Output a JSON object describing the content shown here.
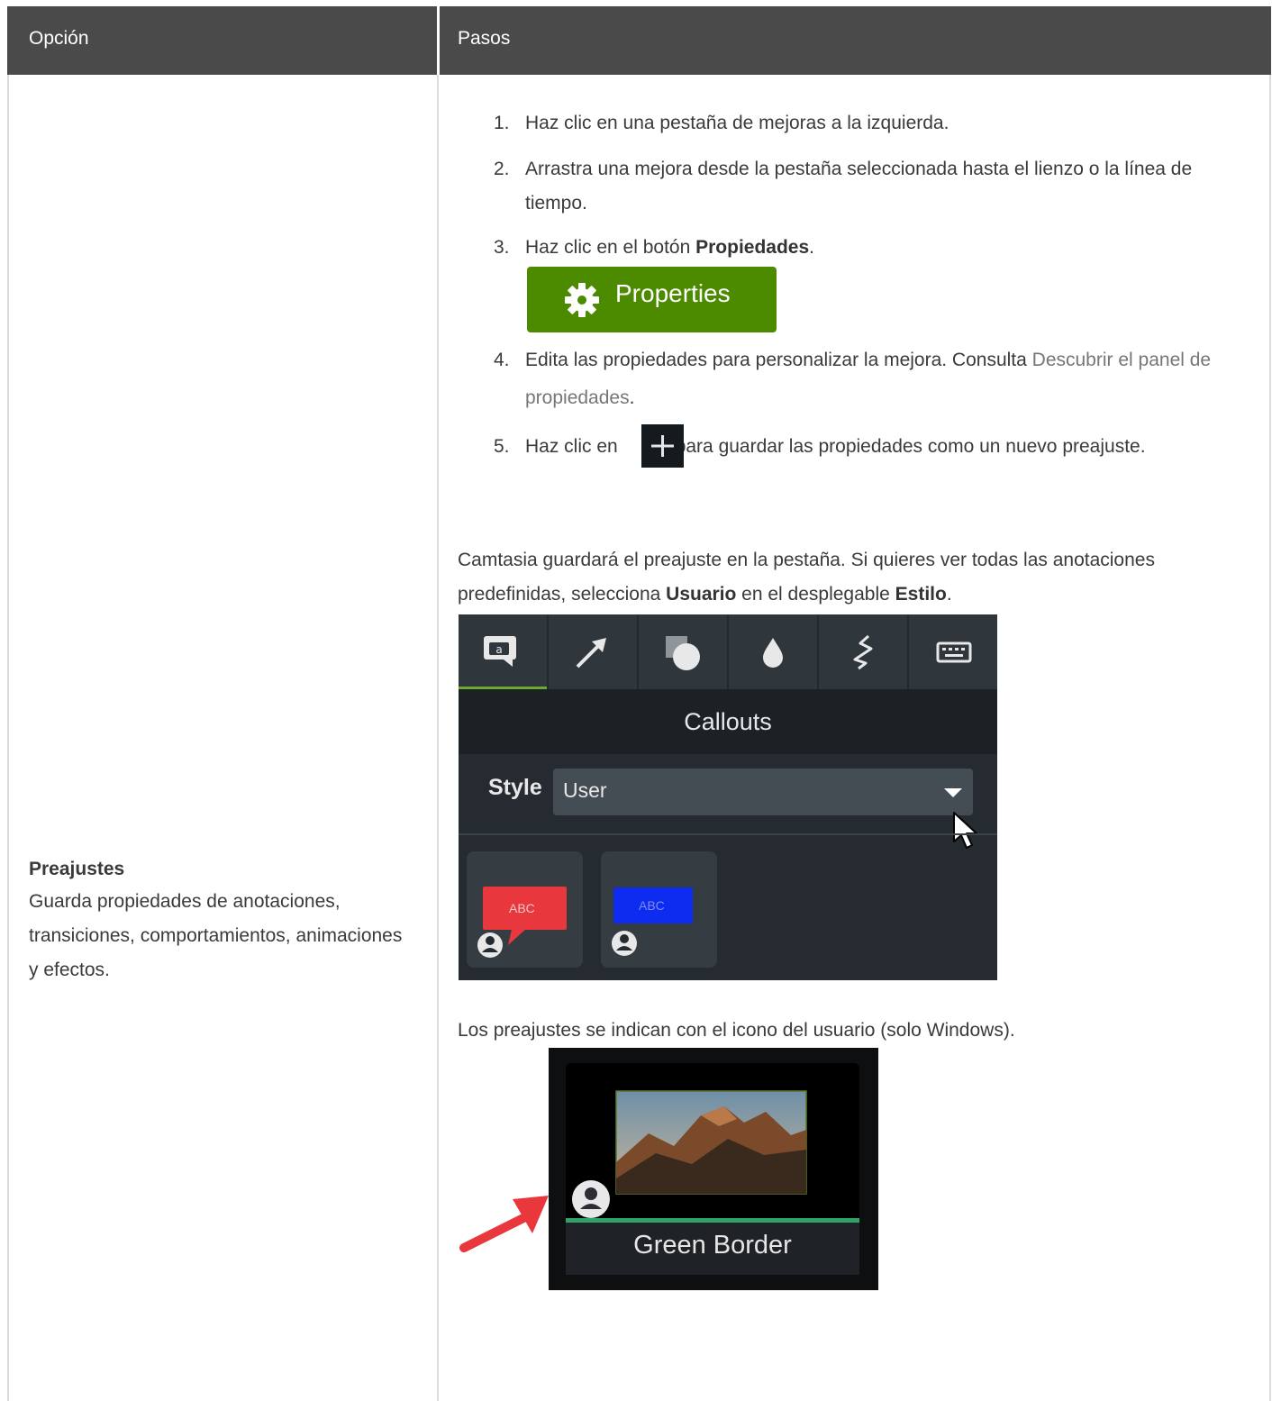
{
  "header": {
    "col_option": "Opción",
    "col_steps": "Pasos"
  },
  "option": {
    "title": "Preajustes",
    "description": "Guarda propiedades de anotaciones, transiciones, comportamientos, animaciones y efectos."
  },
  "steps": [
    {
      "num": "1.",
      "text": "Haz clic en una pestaña de mejoras a la izquierda."
    },
    {
      "num": "2.",
      "text": "Arrastra una mejora desde la pestaña seleccionada hasta el lienzo o la línea de tiempo."
    },
    {
      "num": "3.",
      "text_before": "Haz clic en el botón ",
      "bold": "Propiedades",
      "text_after": "."
    },
    {
      "num": "4.",
      "text_before": "Edita las propiedades para personalizar la mejora. Consulta ",
      "link": "Descubrir el panel de propiedades",
      "text_after": "."
    },
    {
      "num": "5.",
      "text_before": "Haz clic en",
      "text_after": "para guardar las propiedades como un nuevo preajuste."
    }
  ],
  "properties_button": {
    "label": "Properties",
    "icon": "gear-icon",
    "color": "#4c8a00"
  },
  "add_preset_icon": "plus-icon",
  "paragraph1": {
    "text_before": "Camtasia guardará el preajuste en la pestaña. Si quieres ver todas las anotaciones predefinidas, selecciona ",
    "bold1": "Usuario",
    "text_mid": " en el desplegable ",
    "bold2": "Estilo",
    "text_after": "."
  },
  "callouts_panel": {
    "tabs": [
      "callout-icon",
      "arrow-icon",
      "shapes-icon",
      "blur-icon",
      "sketch-icon",
      "keyboard-icon"
    ],
    "title": "Callouts",
    "style_label": "Style",
    "style_value": "User",
    "presets": [
      {
        "text": "ABC",
        "color": "#e8383d"
      },
      {
        "text": "ABC",
        "color": "#0d2cf0"
      }
    ]
  },
  "paragraph2": "Los preajustes se indican con el icono del usuario (solo Windows).",
  "green_border_tile": {
    "label": "Green Border",
    "accent": "#2fa36a"
  }
}
